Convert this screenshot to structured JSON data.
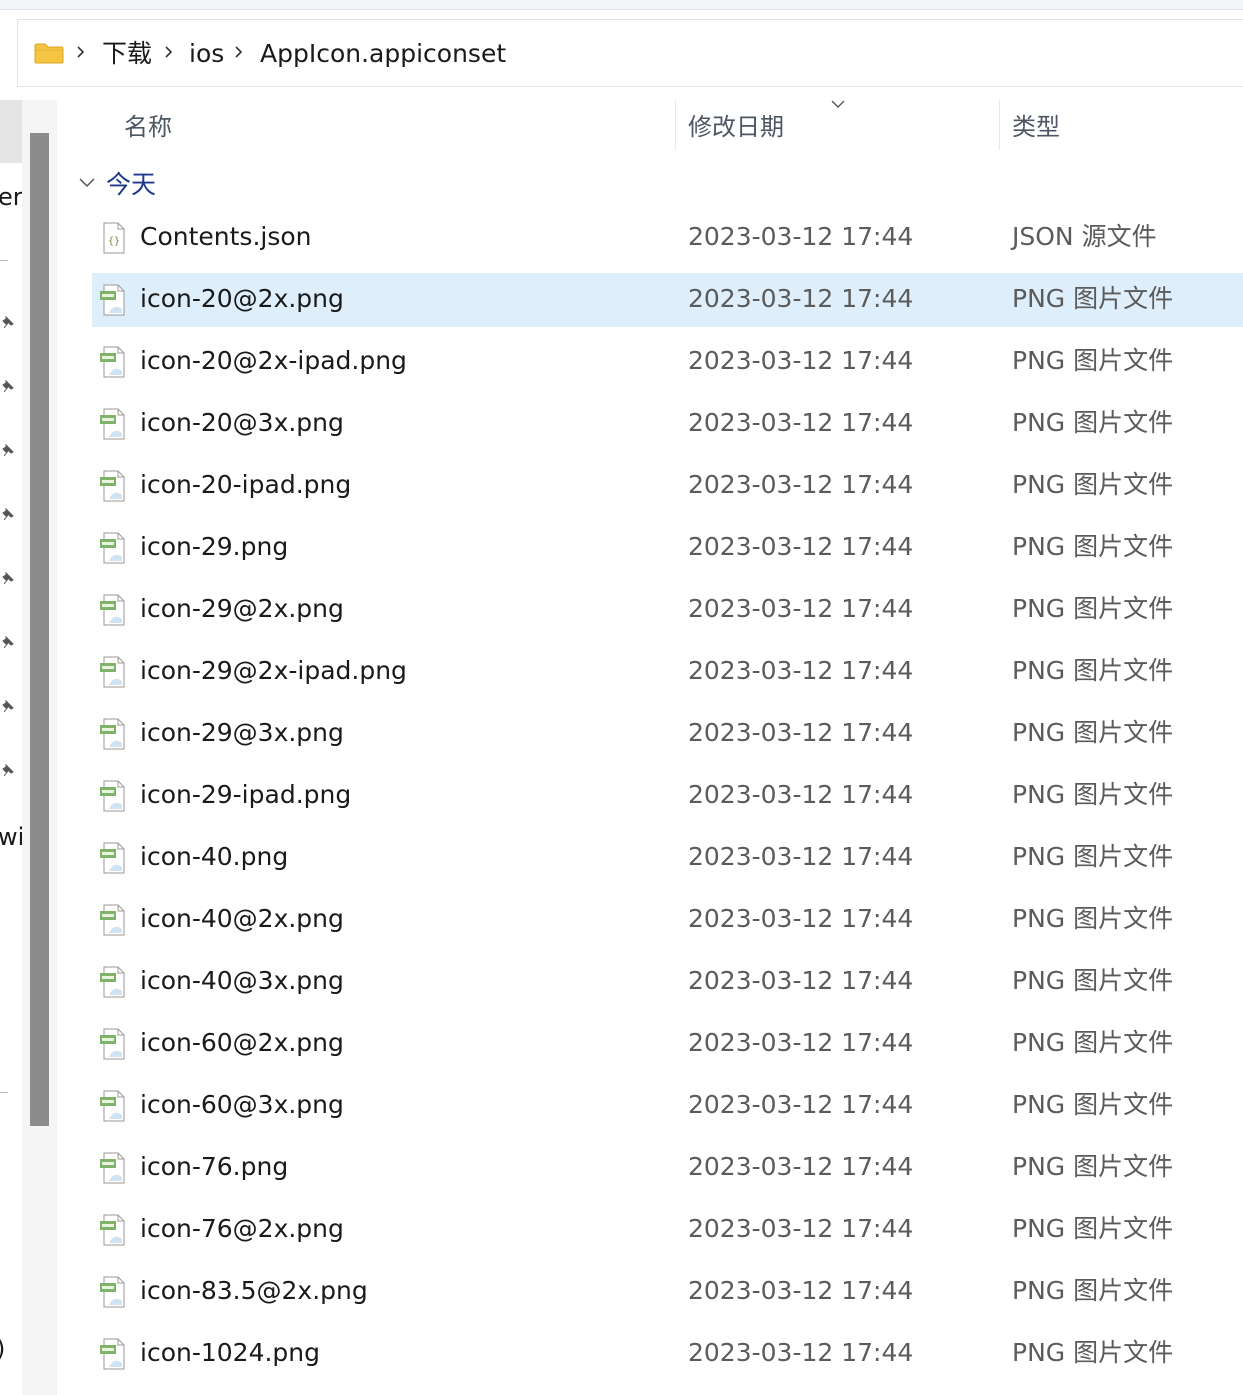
{
  "breadcrumb": {
    "folder_icon": "folder-icon",
    "items": [
      "下载",
      "ios",
      "AppIcon.appiconset"
    ],
    "separator_icon": "chevron-right-icon"
  },
  "navpane": {
    "fragments": [
      "er:",
      "wi",
      ")"
    ],
    "pin_icon": "pin-icon"
  },
  "columns": {
    "name": "名称",
    "date": "修改日期",
    "type": "类型",
    "sort_icon": "chevron-down-icon"
  },
  "group": {
    "label": "今天",
    "expanded": true
  },
  "files": [
    {
      "name": "Contents.json",
      "date": "2023-03-12 17:44",
      "type": "JSON 源文件",
      "icon": "json-file-icon",
      "selected": false
    },
    {
      "name": "icon-20@2x.png",
      "date": "2023-03-12 17:44",
      "type": "PNG 图片文件",
      "icon": "png-file-icon",
      "selected": true
    },
    {
      "name": "icon-20@2x-ipad.png",
      "date": "2023-03-12 17:44",
      "type": "PNG 图片文件",
      "icon": "png-file-icon",
      "selected": false
    },
    {
      "name": "icon-20@3x.png",
      "date": "2023-03-12 17:44",
      "type": "PNG 图片文件",
      "icon": "png-file-icon",
      "selected": false
    },
    {
      "name": "icon-20-ipad.png",
      "date": "2023-03-12 17:44",
      "type": "PNG 图片文件",
      "icon": "png-file-icon",
      "selected": false
    },
    {
      "name": "icon-29.png",
      "date": "2023-03-12 17:44",
      "type": "PNG 图片文件",
      "icon": "png-file-icon",
      "selected": false
    },
    {
      "name": "icon-29@2x.png",
      "date": "2023-03-12 17:44",
      "type": "PNG 图片文件",
      "icon": "png-file-icon",
      "selected": false
    },
    {
      "name": "icon-29@2x-ipad.png",
      "date": "2023-03-12 17:44",
      "type": "PNG 图片文件",
      "icon": "png-file-icon",
      "selected": false
    },
    {
      "name": "icon-29@3x.png",
      "date": "2023-03-12 17:44",
      "type": "PNG 图片文件",
      "icon": "png-file-icon",
      "selected": false
    },
    {
      "name": "icon-29-ipad.png",
      "date": "2023-03-12 17:44",
      "type": "PNG 图片文件",
      "icon": "png-file-icon",
      "selected": false
    },
    {
      "name": "icon-40.png",
      "date": "2023-03-12 17:44",
      "type": "PNG 图片文件",
      "icon": "png-file-icon",
      "selected": false
    },
    {
      "name": "icon-40@2x.png",
      "date": "2023-03-12 17:44",
      "type": "PNG 图片文件",
      "icon": "png-file-icon",
      "selected": false
    },
    {
      "name": "icon-40@3x.png",
      "date": "2023-03-12 17:44",
      "type": "PNG 图片文件",
      "icon": "png-file-icon",
      "selected": false
    },
    {
      "name": "icon-60@2x.png",
      "date": "2023-03-12 17:44",
      "type": "PNG 图片文件",
      "icon": "png-file-icon",
      "selected": false
    },
    {
      "name": "icon-60@3x.png",
      "date": "2023-03-12 17:44",
      "type": "PNG 图片文件",
      "icon": "png-file-icon",
      "selected": false
    },
    {
      "name": "icon-76.png",
      "date": "2023-03-12 17:44",
      "type": "PNG 图片文件",
      "icon": "png-file-icon",
      "selected": false
    },
    {
      "name": "icon-76@2x.png",
      "date": "2023-03-12 17:44",
      "type": "PNG 图片文件",
      "icon": "png-file-icon",
      "selected": false
    },
    {
      "name": "icon-83.5@2x.png",
      "date": "2023-03-12 17:44",
      "type": "PNG 图片文件",
      "icon": "png-file-icon",
      "selected": false
    },
    {
      "name": "icon-1024.png",
      "date": "2023-03-12 17:44",
      "type": "PNG 图片文件",
      "icon": "png-file-icon",
      "selected": false
    }
  ],
  "colors": {
    "selection": "#dfeefb",
    "group_label": "#1f3a8a",
    "folder": "#f5c542",
    "png_badge": "#7fb36a"
  }
}
